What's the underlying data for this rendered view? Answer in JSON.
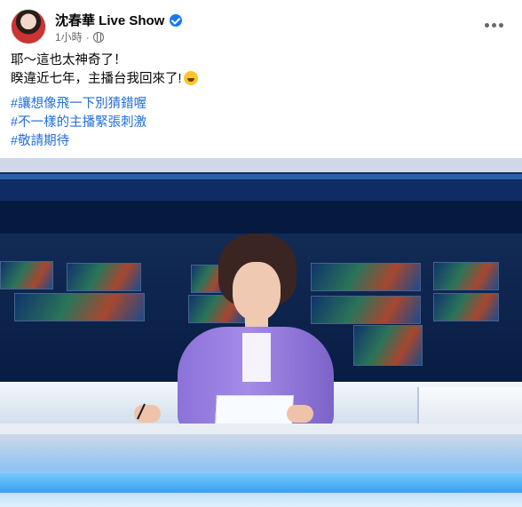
{
  "post": {
    "author": "沈春華 Live Show",
    "time": "1小時",
    "text_lines": [
      "耶～這也太神奇了！",
      "睽違近七年，主播台我回來了!"
    ],
    "hashtags": [
      "#讓想像飛一下別猜錯喔",
      "#不一樣的主播緊張刺激",
      "#敬請期待"
    ]
  },
  "icons": {
    "verified": "verified-badge-icon",
    "privacy": "globe-icon",
    "more": "more-options-icon",
    "emoji": "grinning-emoji-icon"
  },
  "colors": {
    "hashtag": "#216fdb",
    "verified": "#1877f2",
    "meta": "#65676b"
  }
}
